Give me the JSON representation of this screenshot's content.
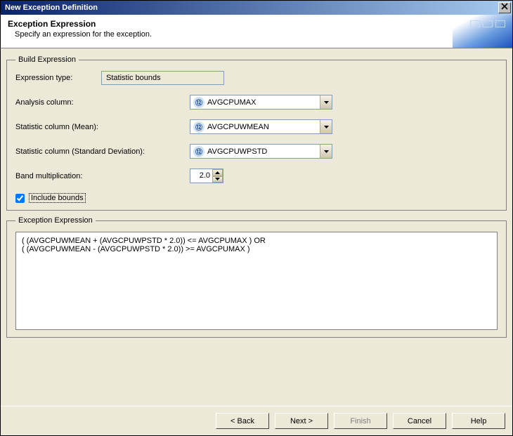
{
  "titlebar": {
    "title": "New Exception Definition"
  },
  "banner": {
    "heading": "Exception Expression",
    "subheading": "Specify an expression for the exception."
  },
  "build": {
    "legend": "Build Expression",
    "expression_type_label": "Expression type:",
    "expression_type_value": "Statistic bounds",
    "analysis_column_label": "Analysis column:",
    "analysis_column_value": "AVGCPUMAX",
    "stat_mean_label": "Statistic column (Mean):",
    "stat_mean_value": "AVGCPUWMEAN",
    "stat_std_label": "Statistic column (Standard Deviation):",
    "stat_std_value": "AVGCPUWPSTD",
    "band_label": "Band multiplication:",
    "band_value": "2.0",
    "include_bounds_label": "Include bounds",
    "include_bounds_checked": true
  },
  "exception": {
    "legend": "Exception Expression",
    "text": "( (AVGCPUWMEAN + (AVGCPUWPSTD * 2.0)) <= AVGCPUMAX ) OR\n( (AVGCPUWMEAN - (AVGCPUWPSTD * 2.0)) >= AVGCPUMAX )"
  },
  "footer": {
    "back": "< Back",
    "next": "Next >",
    "finish": "Finish",
    "cancel": "Cancel",
    "help": "Help"
  }
}
